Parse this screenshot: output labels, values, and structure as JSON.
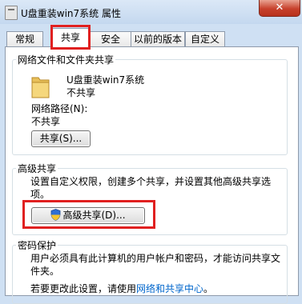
{
  "window": {
    "title": "U盘重装win7系统 属性",
    "close_label": "✕"
  },
  "tabs": [
    {
      "label": "常规"
    },
    {
      "label": "共享"
    },
    {
      "label": "安全"
    },
    {
      "label": "以前的版本"
    },
    {
      "label": "自定义"
    }
  ],
  "network_sharing": {
    "heading": "网络文件和文件夹共享",
    "folder_name": "U盘重装win7系统",
    "share_status": "不共享",
    "path_label": "网络路径(N):",
    "path_value": "不共享",
    "share_button": "共享(S)..."
  },
  "advanced_sharing": {
    "heading": "高级共享",
    "description": "设置自定义权限，创建多个共享，并设置其他高级共享选项。",
    "button": "高级共享(D)..."
  },
  "password_protection": {
    "heading": "密码保护",
    "description": "用户必须具有此计算机的用户帐户和密码，才能访问共享文件夹。",
    "prefix": "若要更改此设置，请使用",
    "link": "网络和共享中心",
    "suffix": "。"
  }
}
